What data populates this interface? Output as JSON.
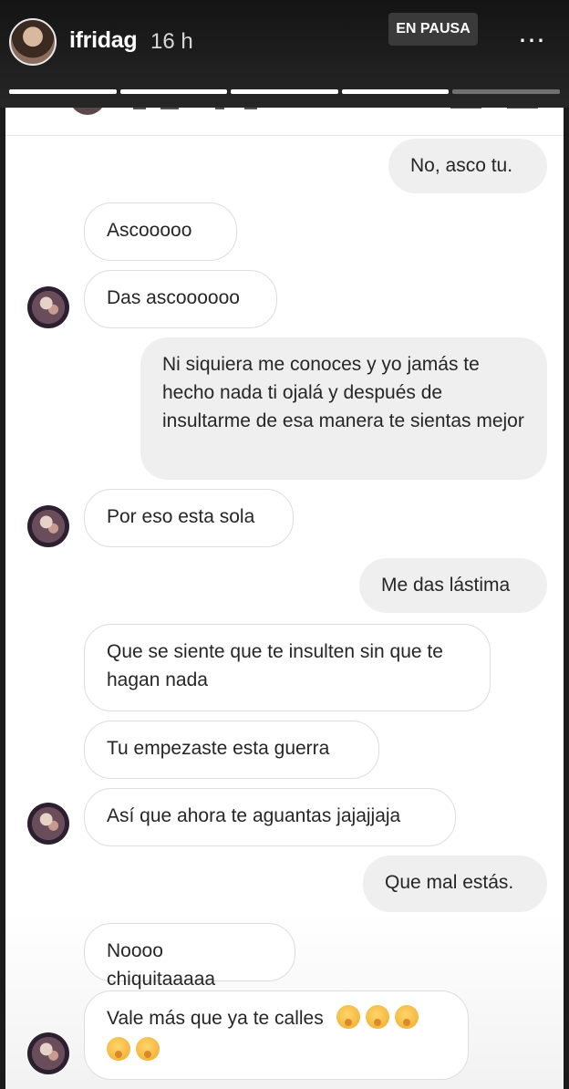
{
  "story": {
    "username": "ifridag",
    "time_ago": "16 h",
    "paused_label": "EN PAUSA",
    "more_icon": "⋯",
    "segments_total": 5,
    "segments_done": 4
  },
  "conversation": {
    "messages": [
      {
        "side": "out",
        "text": "No, asco tu."
      },
      {
        "side": "in",
        "text": "Ascooooo"
      },
      {
        "side": "in",
        "text": "Das ascoooooo"
      },
      {
        "side": "out",
        "text": "Ni siquiera me conoces y yo jamás te hecho nada ti ojalá y después de insultarme de esa manera te sientas mejor"
      },
      {
        "side": "in",
        "text": "Por eso esta sola"
      },
      {
        "side": "out",
        "text": "Me das lástima"
      },
      {
        "side": "in",
        "text": "Que se siente que te insulten sin que te hagan nada"
      },
      {
        "side": "in",
        "text": "Tu empezaste esta guerra"
      },
      {
        "side": "in",
        "text": "Así que ahora te aguantas jajajjaja"
      },
      {
        "side": "out",
        "text": "Que mal estás."
      },
      {
        "side": "in",
        "text": "Noooo chiquitaaaaa"
      },
      {
        "side": "in",
        "text": "Vale más que ya te calles",
        "emoji": "shushing-face",
        "emoji_count": 5
      }
    ]
  }
}
